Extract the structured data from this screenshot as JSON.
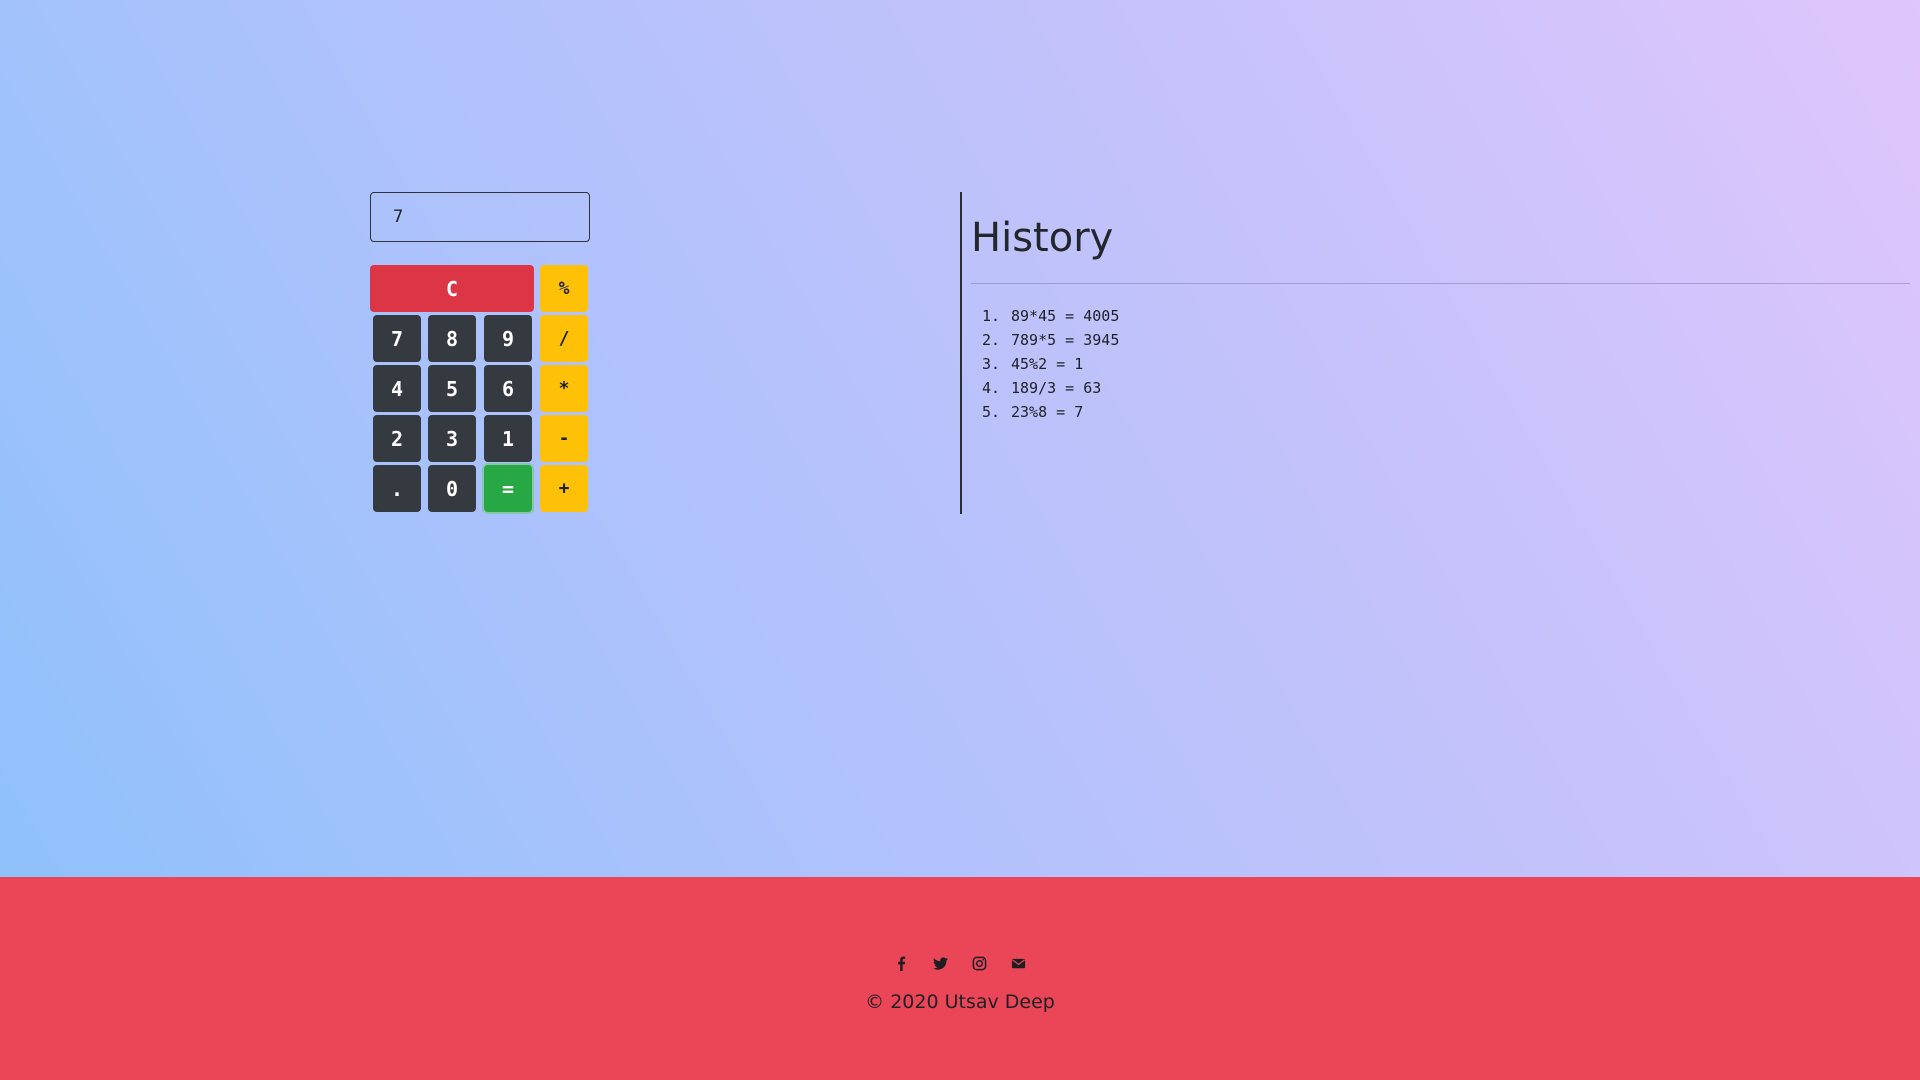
{
  "calculator": {
    "display_value": "7",
    "keys": {
      "clear": "C",
      "percent": "%",
      "divide": "/",
      "multiply": "*",
      "subtract": "-",
      "add": "+",
      "equals": "=",
      "dot": ".",
      "k0": "0",
      "k1": "1",
      "k2": "2",
      "k3": "3",
      "k4": "4",
      "k5": "5",
      "k6": "6",
      "k7": "7",
      "k8": "8",
      "k9": "9"
    }
  },
  "history": {
    "title": "History",
    "items": [
      {
        "num": "1.",
        "text": "89*45 = 4005"
      },
      {
        "num": "2.",
        "text": "789*5 = 3945"
      },
      {
        "num": "3.",
        "text": "45%2 = 1"
      },
      {
        "num": "4.",
        "text": "189/3 = 63"
      },
      {
        "num": "5.",
        "text": "23%8 = 7"
      }
    ]
  },
  "footer": {
    "social_icons": [
      "facebook-icon",
      "twitter-icon",
      "instagram-icon",
      "envelope-icon"
    ],
    "copyright": "© 2020 Utsav Deep"
  },
  "colors": {
    "digit_key": "#343a40",
    "operator_key": "#ffc107",
    "equals_key": "#28a745",
    "clear_key": "#dc3545",
    "footer_bg": "#ea4658"
  }
}
